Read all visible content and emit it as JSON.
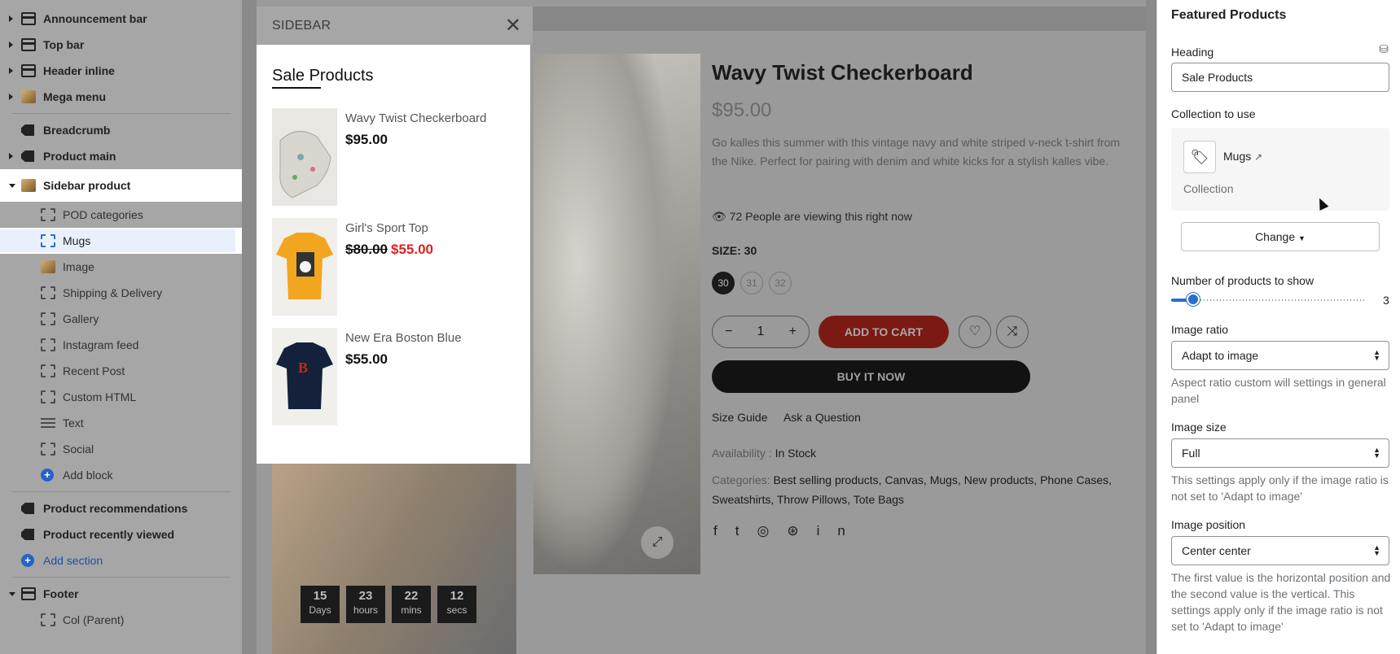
{
  "outline": {
    "items": [
      {
        "label": "Announcement bar",
        "icon": "layout-bar-icon"
      },
      {
        "label": "Top bar",
        "icon": "layout-bar-icon"
      },
      {
        "label": "Header inline",
        "icon": "layout-bar-icon"
      },
      {
        "label": "Mega menu",
        "icon": "image-icon"
      },
      {
        "label": "Breadcrumb",
        "icon": "tag-icon"
      },
      {
        "label": "Product main",
        "icon": "tag-icon"
      },
      {
        "label": "Sidebar product",
        "icon": "image-icon"
      }
    ],
    "blocks": [
      {
        "label": "POD categories"
      },
      {
        "label": "Mugs"
      },
      {
        "label": "Image"
      },
      {
        "label": "Shipping & Delivery"
      },
      {
        "label": "Gallery"
      },
      {
        "label": "Instagram feed"
      },
      {
        "label": "Recent Post"
      },
      {
        "label": "Custom HTML"
      },
      {
        "label": "Text"
      },
      {
        "label": "Social"
      }
    ],
    "add_block": "Add block",
    "after": [
      {
        "label": "Product recommendations"
      },
      {
        "label": "Product recently viewed"
      }
    ],
    "add_section": "Add section",
    "footer": "Footer",
    "footer_child": "Col (Parent)"
  },
  "preview": {
    "title": "Wavy Twist Checkerboard",
    "price": "$95.00",
    "description": "Go kalles this summer with this vintage navy and white striped v-neck t-shirt from the Nike. Perfect for pairing with denim and white kicks for a stylish kalles vibe.",
    "viewing": "72 People are viewing this right now",
    "size_label": "SIZE:",
    "size_value": "30",
    "sizes": [
      "30",
      "31",
      "32"
    ],
    "qty": "1",
    "add_to_cart": "ADD TO CART",
    "buy_now": "BUY IT NOW",
    "size_guide": "Size Guide",
    "ask": "Ask a Question",
    "availability_label": "Availability :",
    "availability": "In Stock",
    "categories_label": "Categories:",
    "categories": "Best selling products, Canvas, Mugs, New products, Phone Cases, Sweatshirts, Throw Pillows, Tote Bags",
    "countdown": [
      {
        "num": "15",
        "unit": "Days"
      },
      {
        "num": "23",
        "unit": "hours"
      },
      {
        "num": "22",
        "unit": "mins"
      },
      {
        "num": "12",
        "unit": "secs"
      }
    ]
  },
  "sidebar": {
    "title": "SIDEBAR",
    "heading": "Sale Products",
    "products": [
      {
        "name": "Wavy Twist Checkerboard",
        "price": "$95.00"
      },
      {
        "name": "Girl's Sport Top",
        "old_price": "$80.00",
        "price": "$55.00"
      },
      {
        "name": "New Era Boston Blue",
        "price": "$55.00"
      }
    ]
  },
  "settings": {
    "title": "Featured Products",
    "heading_label": "Heading",
    "heading_value": "Sale Products",
    "collection_label": "Collection to use",
    "collection_name": "Mugs",
    "collection_type": "Collection",
    "change": "Change",
    "num_label": "Number of products to show",
    "num_value": "3",
    "ratio_label": "Image ratio",
    "ratio_value": "Adapt to image",
    "ratio_help": "Aspect ratio custom will settings in general panel",
    "size_label": "Image size",
    "size_value": "Full",
    "size_help": "This settings apply only if the image ratio is not set to 'Adapt to image'",
    "position_label": "Image position",
    "position_value": "Center center",
    "position_help": "The first value is the horizontal position and the second value is the vertical. This settings apply only if the image ratio is not set to 'Adapt to image'"
  }
}
